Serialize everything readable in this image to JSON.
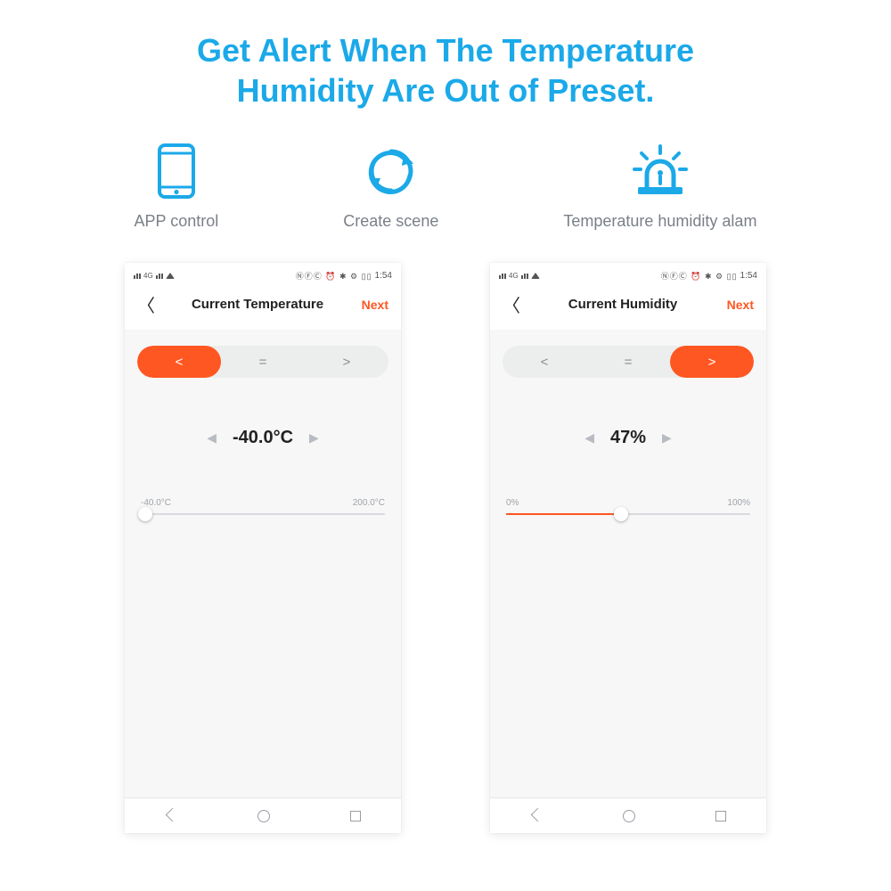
{
  "headline": {
    "line1": "Get Alert When The Temperature",
    "line2": "Humidity Are Out of Preset."
  },
  "features": [
    {
      "icon": "phone",
      "label": "APP control"
    },
    {
      "icon": "refresh",
      "label": "Create scene"
    },
    {
      "icon": "alarm",
      "label": "Temperature humidity alam"
    }
  ],
  "colors": {
    "accent_blue": "#1ba9e8",
    "accent_orange": "#ff5722"
  },
  "phones": [
    {
      "status_time": "1:54",
      "title": "Current Temperature",
      "next_label": "Next",
      "operators": {
        "lt": "<",
        "eq": "=",
        "gt": ">",
        "active": "lt"
      },
      "value": "-40.0°C",
      "slider": {
        "min_label": "-40.0°C",
        "max_label": "200.0°C",
        "fill_percent": 0,
        "thumb_percent": 2
      }
    },
    {
      "status_time": "1:54",
      "title": "Current Humidity",
      "next_label": "Next",
      "operators": {
        "lt": "<",
        "eq": "=",
        "gt": ">",
        "active": "gt"
      },
      "value": "47%",
      "slider": {
        "min_label": "0%",
        "max_label": "100%",
        "fill_percent": 47,
        "thumb_percent": 47
      }
    }
  ],
  "stepper": {
    "left": "◀",
    "right": "▶"
  },
  "status_icons": "NFC ⏰ ⚙ ✱ ▮▯"
}
